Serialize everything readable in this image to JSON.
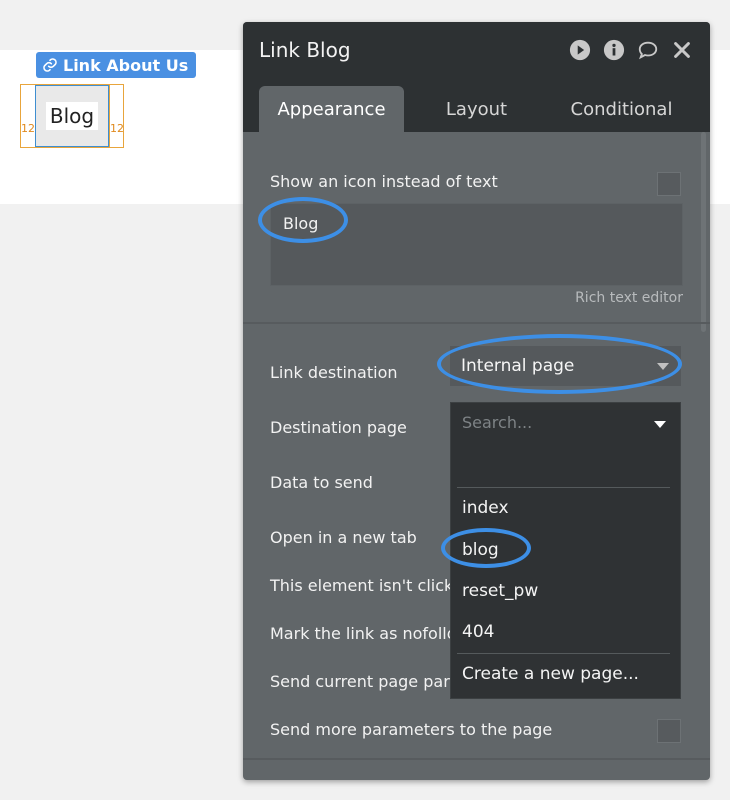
{
  "canvas": {
    "link_tag": "Link About Us",
    "element_text": "Blog",
    "padding_left": "12",
    "padding_right": "12"
  },
  "panel": {
    "title": "Link Blog",
    "tabs": [
      {
        "label": "Appearance",
        "active": true
      },
      {
        "label": "Layout",
        "active": false
      },
      {
        "label": "Conditional",
        "active": false
      }
    ],
    "show_icon_label": "Show an icon instead of text",
    "text_value": "Blog",
    "rich_text_editor": "Rich text editor",
    "link_destination_label": "Link destination",
    "link_destination_value": "Internal page",
    "destination_page_label": "Destination page",
    "data_to_send_label": "Data to send",
    "open_new_tab_label": "Open in a new tab",
    "not_clickable_label": "This element isn't clicka",
    "nofollow_label": "Mark the link as nofollo",
    "send_params_label": "Send current page para",
    "send_more_params_label": "Send more parameters to the page",
    "dropdown": {
      "search_placeholder": "Search...",
      "pages": [
        "index",
        "blog",
        "reset_pw",
        "404"
      ],
      "create_new": "Create a new page..."
    }
  },
  "colors": {
    "accent": "#3d8fe6",
    "panel_bg": "#616669",
    "header_bg": "#2d3133"
  }
}
